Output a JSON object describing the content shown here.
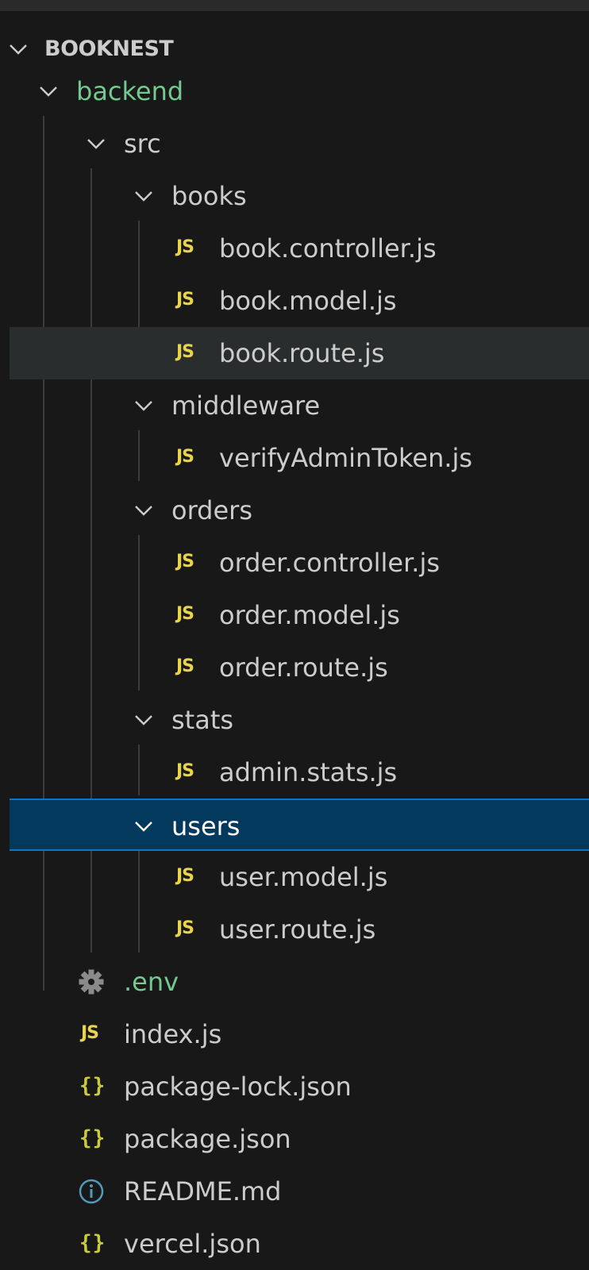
{
  "explorer": {
    "root_title": "BOOKNEST",
    "tree": [
      {
        "label": "backend",
        "kind": "folder",
        "depth": 1
      },
      {
        "label": "src",
        "kind": "folder",
        "depth": 2
      },
      {
        "label": "books",
        "kind": "folder",
        "depth": 3
      },
      {
        "label": "book.controller.js",
        "kind": "js",
        "depth": 4
      },
      {
        "label": "book.model.js",
        "kind": "js",
        "depth": 4
      },
      {
        "label": "book.route.js",
        "kind": "js",
        "depth": 4
      },
      {
        "label": "middleware",
        "kind": "folder",
        "depth": 3
      },
      {
        "label": "verifyAdminToken.js",
        "kind": "js",
        "depth": 4
      },
      {
        "label": "orders",
        "kind": "folder",
        "depth": 3
      },
      {
        "label": "order.controller.js",
        "kind": "js",
        "depth": 4
      },
      {
        "label": "order.model.js",
        "kind": "js",
        "depth": 4
      },
      {
        "label": "order.route.js",
        "kind": "js",
        "depth": 4
      },
      {
        "label": "stats",
        "kind": "folder",
        "depth": 3
      },
      {
        "label": "admin.stats.js",
        "kind": "js",
        "depth": 4
      },
      {
        "label": "users",
        "kind": "folder",
        "depth": 3
      },
      {
        "label": "user.model.js",
        "kind": "js",
        "depth": 4
      },
      {
        "label": "user.route.js",
        "kind": "js",
        "depth": 4
      },
      {
        "label": ".env",
        "kind": "env",
        "depth": 2
      },
      {
        "label": "index.js",
        "kind": "js",
        "depth": 2
      },
      {
        "label": "package-lock.json",
        "kind": "json",
        "depth": 2
      },
      {
        "label": "package.json",
        "kind": "json",
        "depth": 2
      },
      {
        "label": "README.md",
        "kind": "info",
        "depth": 2
      },
      {
        "label": "vercel.json",
        "kind": "json",
        "depth": 2
      }
    ],
    "icon_text": {
      "js": "JS",
      "json": "{}"
    },
    "colors": {
      "background": "#181818",
      "selected": "#04395e",
      "selected_border": "#0a76c7",
      "hover": "#2a2d2e",
      "js_icon": "#e8d44d",
      "json_icon": "#cbcb41",
      "modified_green": "#73c991"
    }
  }
}
